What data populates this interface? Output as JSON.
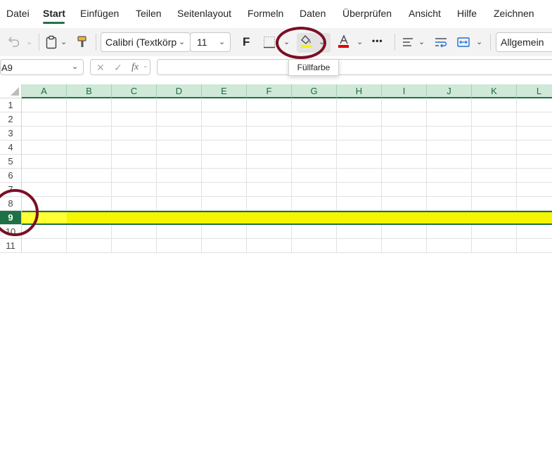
{
  "menu": {
    "tabs": [
      "Datei",
      "Start",
      "Einfügen",
      "Teilen",
      "Seitenlayout",
      "Formeln",
      "Daten",
      "Überprüfen",
      "Ansicht",
      "Hilfe",
      "Zeichnen"
    ],
    "active": "Start"
  },
  "ribbon": {
    "font_name": "Calibri (Textkörp",
    "font_size": "11",
    "bold_label": "F",
    "more_label": "•••",
    "number_format": "Allgemein",
    "fill_color": "#f5f500",
    "font_color": "#e00000",
    "fill_tooltip": "Füllfarbe"
  },
  "formula_bar": {
    "name_box": "A9",
    "cancel_symbol": "✕",
    "enter_symbol": "✓",
    "fx_label": "fx",
    "formula": ""
  },
  "sheet": {
    "columns": [
      "A",
      "B",
      "C",
      "D",
      "E",
      "F",
      "G",
      "H",
      "I",
      "J",
      "K",
      "L"
    ],
    "rows": [
      "1",
      "2",
      "3",
      "4",
      "5",
      "6",
      "7",
      "8",
      "9",
      "10",
      "11"
    ],
    "selected_row": "9",
    "highlight_color": "#f5f500",
    "accent_color": "#1e7145"
  },
  "annotation": {
    "circle_color": "#7b0f24"
  }
}
